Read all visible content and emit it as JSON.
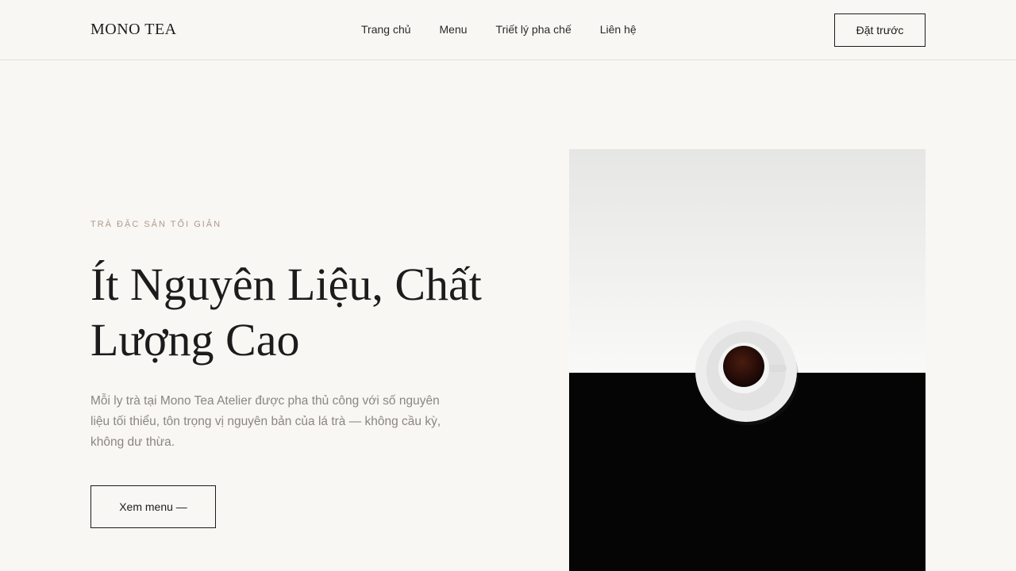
{
  "header": {
    "logo": "MONO TEA",
    "nav": [
      "Trang chủ",
      "Menu",
      "Triết lý pha chế",
      "Liên hệ"
    ],
    "cta": "Đặt trước"
  },
  "hero": {
    "eyebrow": "TRÀ ĐẶC SẢN TỐI GIẢN",
    "title_line1": "Ít Nguyên Liệu, Chất",
    "title_line2": "Lượng Cao",
    "body": "Mỗi ly trà tại Mono Tea Atelier được pha thủ công với số nguyên liệu tối thiểu, tôn trọng vị nguyên bản của lá trà — không cầu kỳ, không dư thừa.",
    "button": "Xem menu —",
    "image_icon": "tea-cup-photo"
  },
  "colors": {
    "background": "#f8f7f4",
    "text": "#1c1c1c",
    "eyebrow": "#b19a8a",
    "body": "#8a8683"
  }
}
